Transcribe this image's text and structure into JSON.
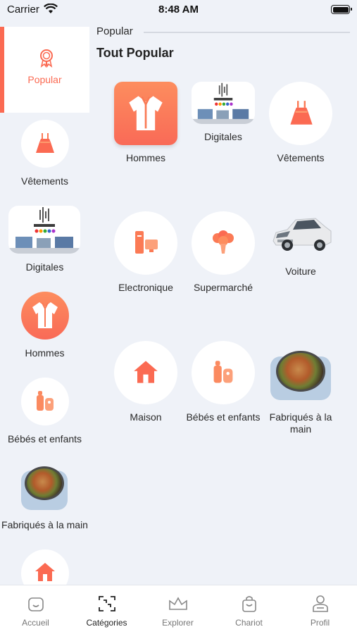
{
  "status_bar": {
    "carrier": "Carrier",
    "time": "8:48 AM"
  },
  "breadcrumb": "Popular",
  "section_title": "Tout Popular",
  "sidebar": {
    "items": [
      {
        "label": "Popular",
        "icon": "award-icon",
        "active": true
      },
      {
        "label": "Vêtements",
        "icon": "dress-icon"
      },
      {
        "label": "Digitales",
        "icon": "digital-thumbnail"
      },
      {
        "label": "Hommes",
        "icon": "shirt-icon"
      },
      {
        "label": "Bébés et enfants",
        "icon": "baby-icon"
      },
      {
        "label": "Fabriqués à la main",
        "icon": "handmade-bowl"
      },
      {
        "label": "",
        "icon": "house-icon"
      }
    ]
  },
  "grid": {
    "items": [
      {
        "label": "Hommes",
        "icon": "shirt-icon"
      },
      {
        "label": "Digitales",
        "icon": "digital-thumbnail"
      },
      {
        "label": "Vêtements",
        "icon": "dress-icon"
      },
      {
        "label": "Electronique",
        "icon": "electronics-icon"
      },
      {
        "label": "Supermarché",
        "icon": "broccoli-icon"
      },
      {
        "label": "Voiture",
        "icon": "car-image"
      },
      {
        "label": "Maison",
        "icon": "house-icon"
      },
      {
        "label": "Bébés et enfants",
        "icon": "baby-icon"
      },
      {
        "label": "Fabriqués à la main",
        "icon": "handmade-bowl"
      }
    ]
  },
  "tabbar": {
    "items": [
      {
        "label": "Accueil",
        "icon": "home-icon"
      },
      {
        "label": "Catégories",
        "icon": "categories-icon",
        "active": true
      },
      {
        "label": "Explorer",
        "icon": "crown-icon"
      },
      {
        "label": "Chariot",
        "icon": "bag-icon"
      },
      {
        "label": "Profil",
        "icon": "user-icon"
      }
    ]
  },
  "colors": {
    "accent": "#fb6a52",
    "background": "#eff2f8"
  }
}
